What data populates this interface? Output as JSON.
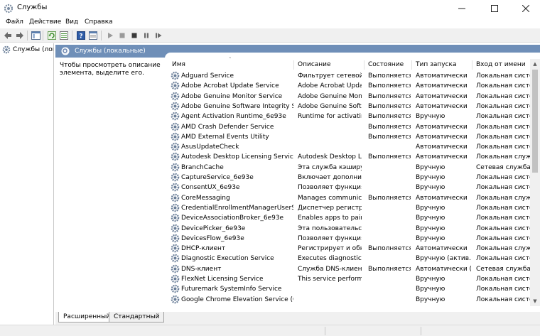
{
  "window": {
    "title": "Службы"
  },
  "menu": [
    "Файл",
    "Действие",
    "Вид",
    "Справка"
  ],
  "nav": {
    "item": "Службы (локальные)"
  },
  "main": {
    "header": "Службы (локальные)",
    "description": "Чтобы просмотреть описание элемента, выделите его."
  },
  "columns": [
    "Имя",
    "Описание",
    "Состояние",
    "Тип запуска",
    "Вход от имени"
  ],
  "services": [
    [
      "Adguard Service",
      "Фильтрует сетевой ...",
      "Выполняется",
      "Автоматически",
      "Локальная систе..."
    ],
    [
      "Adobe Acrobat Update Service",
      "Adobe Acrobat Upda...",
      "Выполняется",
      "Автоматически",
      "Локальная систе..."
    ],
    [
      "Adobe Genuine Monitor Service",
      "Adobe Genuine Mon...",
      "Выполняется",
      "Автоматически",
      "Локальная систе..."
    ],
    [
      "Adobe Genuine Software Integrity Ser...",
      "Adobe Genuine Soft...",
      "Выполняется",
      "Автоматически",
      "Локальная систе..."
    ],
    [
      "Agent Activation Runtime_6e93e",
      "Runtime for activatin...",
      "Выполняется",
      "Вручную",
      "Локальная систе..."
    ],
    [
      "AMD Crash Defender Service",
      "",
      "Выполняется",
      "Автоматически",
      "Локальная систе..."
    ],
    [
      "AMD External Events Utility",
      "",
      "Выполняется",
      "Автоматически",
      "Локальная систе..."
    ],
    [
      "AsusUpdateCheck",
      "",
      "",
      "Автоматически",
      "Локальная систе..."
    ],
    [
      "Autodesk Desktop Licensing Service",
      "Autodesk Desktop Li...",
      "Выполняется",
      "Автоматически",
      "Локальная служба"
    ],
    [
      "BranchCache",
      "Эта служба кэширу...",
      "",
      "Вручную",
      "Сетевая служба"
    ],
    [
      "CaptureService_6e93e",
      "Включает дополнит...",
      "",
      "Вручную",
      "Локальная систе..."
    ],
    [
      "ConsentUX_6e93e",
      "Позволяет функция...",
      "",
      "Вручную",
      "Локальная систе..."
    ],
    [
      "CoreMessaging",
      "Manages communic...",
      "Выполняется",
      "Автоматически",
      "Локальная служба"
    ],
    [
      "CredentialEnrollmentManagerUserSvc...",
      "Диспетчер регистра...",
      "",
      "Вручную",
      "Локальная систе..."
    ],
    [
      "DeviceAssociationBroker_6e93e",
      "Enables apps to pair ...",
      "",
      "Вручную",
      "Локальная систе..."
    ],
    [
      "DevicePicker_6e93e",
      "Эта пользовательск...",
      "",
      "Вручную",
      "Локальная систе..."
    ],
    [
      "DevicesFlow_6e93e",
      "Позволяет функция...",
      "",
      "Вручную",
      "Локальная систе..."
    ],
    [
      "DHCP-клиент",
      "Регистрирует и обн...",
      "Выполняется",
      "Автоматически",
      "Локальная служба"
    ],
    [
      "Diagnostic Execution Service",
      "Executes diagnostic ...",
      "",
      "Вручную (актив...",
      "Локальная систе..."
    ],
    [
      "DNS-клиент",
      "Служба DNS-клиен...",
      "Выполняется",
      "Автоматически (...",
      "Сетевая служба"
    ],
    [
      "FlexNet Licensing Service",
      "This service perform...",
      "",
      "Вручную",
      "Локальная систе..."
    ],
    [
      "Futuremark SystemInfo Service",
      "",
      "",
      "Вручную",
      "Локальная систе..."
    ],
    [
      "Google Chrome Elevation Service (Go...",
      "",
      "",
      "Вручную",
      "Локальная систе..."
    ]
  ],
  "tabs": [
    "Расширенный",
    "Стандартный"
  ],
  "colors": {
    "header_band": "#6f8fb8",
    "gear": "#6b7f99"
  }
}
